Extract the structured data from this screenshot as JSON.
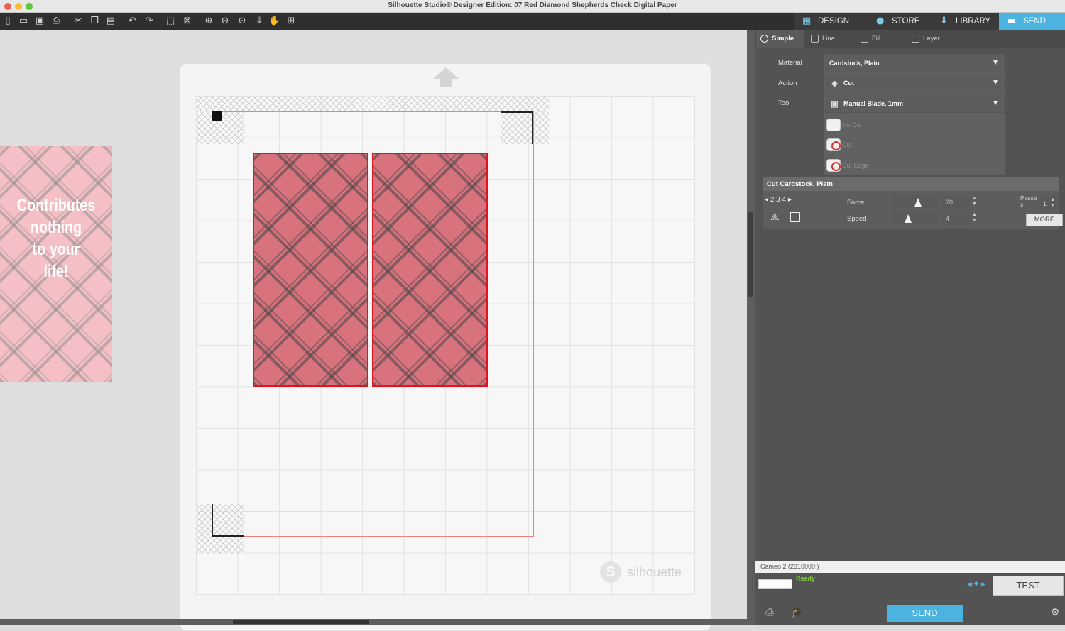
{
  "window": {
    "title": "Silhouette Studio® Designer Edition: 07 Red Diamond Shepherds Check Digital Paper"
  },
  "toolbar": {
    "icons": [
      "new-document-icon",
      "open-folder-icon",
      "save-icon",
      "print-icon",
      "cut-icon",
      "copy-icon",
      "paste-icon",
      "undo-icon",
      "redo-icon",
      "select-all-icon",
      "deselect-icon",
      "zoom-in-icon",
      "zoom-out-icon",
      "zoom-select-icon",
      "move-down-icon",
      "pan-hand-icon",
      "fit-to-page-icon"
    ]
  },
  "nav_tabs": [
    {
      "label": "DESIGN",
      "icon": "grid-icon"
    },
    {
      "label": "STORE",
      "icon": "silhouette-s-icon"
    },
    {
      "label": "LIBRARY",
      "icon": "download-icon"
    },
    {
      "label": "SEND",
      "icon": "cameo-icon",
      "active": true
    }
  ],
  "canvas": {
    "preview_text": "Contributes\nnothing\nto your\nlife!",
    "watermark": "silhouette",
    "watermark_logo": "S"
  },
  "panel": {
    "mode_tabs": [
      {
        "label": "Simple",
        "active": true
      },
      {
        "label": "Line"
      },
      {
        "label": "Fill"
      },
      {
        "label": "Layer"
      }
    ],
    "material_label": "Material",
    "material_value": "Cardstock, Plain",
    "action_label": "Action",
    "action_value": "Cut",
    "tool_label": "Tool",
    "tool_value": "Manual Blade, 1mm",
    "options": [
      "No Cut",
      "Cut",
      "Cut Edge"
    ],
    "cut_header": "Cut Cardstock, Plain",
    "blade_digits": "2 3 4",
    "force_label": "Force",
    "force_value": "20",
    "force_level": 0.55,
    "speed_label": "Speed",
    "speed_value": "4",
    "speed_level": 0.3,
    "passes_label": "Passes",
    "passes_value": "1",
    "more_label": "MORE",
    "machine": "Cameo 2 (2310000:)",
    "status": "Ready",
    "test_label": "TEST",
    "send_label": "SEND"
  },
  "colors": {
    "accent": "#4ab3df",
    "cut_line": "#e0141e",
    "paper": "#d8737d",
    "ready": "#7fd23a"
  }
}
